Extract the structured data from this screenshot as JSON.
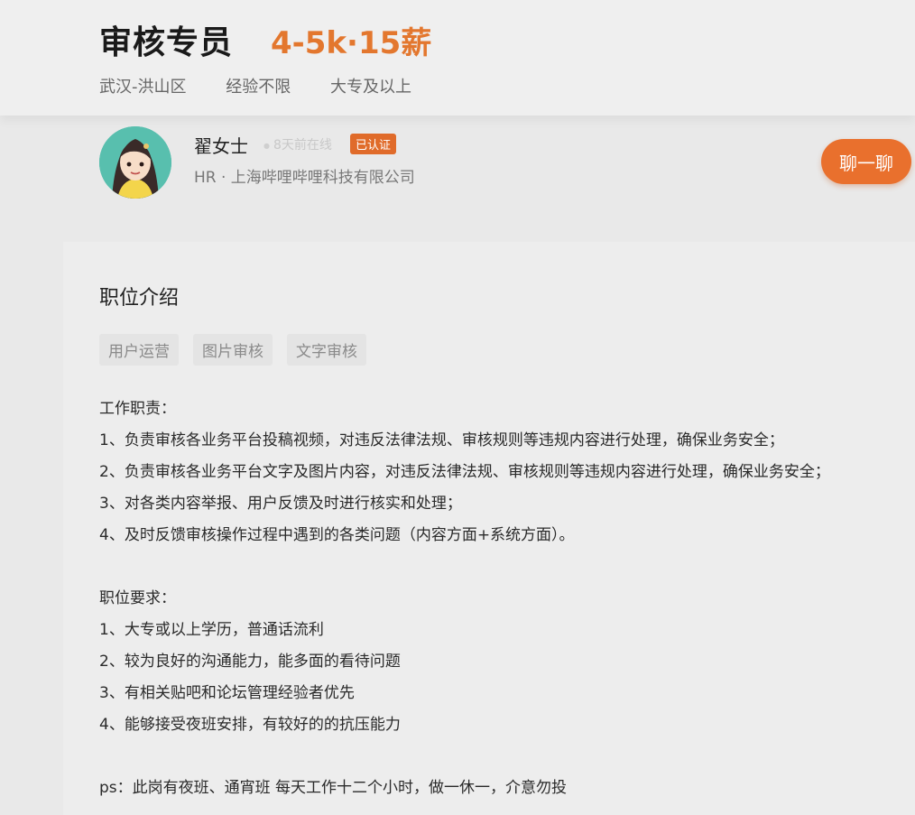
{
  "job": {
    "title": "审核专员",
    "salary": "4-5k·15薪",
    "location": "武汉-洪山区",
    "experience": "经验不限",
    "education": "大专及以上"
  },
  "recruiter": {
    "name": "翟女士",
    "online_status": "8天前在线",
    "verified_badge": "已认证",
    "company": "HR · 上海哔哩哔哩科技有限公司",
    "chat_button": "聊一聊",
    "accent_color": "#e9702d"
  },
  "description": {
    "section_title": "职位介绍",
    "tags": [
      "用户运营",
      "图片审核",
      "文字审核"
    ],
    "duties_heading": "工作职责：",
    "duties": [
      "1、负责审核各业务平台投稿视频，对违反法律法规、审核规则等违规内容进行处理，确保业务安全；",
      "2、负责审核各业务平台文字及图片内容，对违反法律法规、审核规则等违规内容进行处理，确保业务安全；",
      "3、对各类内容举报、用户反馈及时进行核实和处理；",
      "4、及时反馈审核操作过程中遇到的各类问题（内容方面+系统方面）。"
    ],
    "requirements_heading": "职位要求：",
    "requirements": [
      "1、大专或以上学历，普通话流利",
      "2、较为良好的沟通能力，能多面的看待问题",
      "3、有相关贴吧和论坛管理经验者优先",
      "4、能够接受夜班安排，有较好的的抗压能力"
    ],
    "ps": "ps：此岗有夜班、通宵班  每天工作十二个小时，做一休一，介意勿投"
  }
}
